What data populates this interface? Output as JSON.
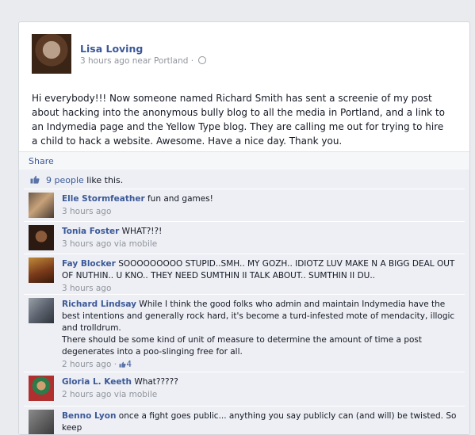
{
  "post": {
    "author": "Lisa Loving",
    "time": "3 hours ago",
    "location": "near Portland",
    "separator": "·",
    "text": "Hi everybody!!! Now someone named Richard Smith has sent a screenie of my post about hacking into the anonymous bully blog to all the media in Portland, and a link to an Indymedia page and the Yellow Type blog. They are calling me out for trying to hire a child to hack a website. Awesome. Have a nice day. Thank you."
  },
  "actions": {
    "share": "Share"
  },
  "likes": {
    "count_text": "9 people",
    "suffix": " like this."
  },
  "comments": [
    {
      "name": "Elle Stormfeather",
      "text": " fun and games!",
      "time": "3 hours ago",
      "via": ""
    },
    {
      "name": "Tonia Foster",
      "text": " WHAT?!?!",
      "time": "3 hours ago",
      "via": " via mobile"
    },
    {
      "name": "Fay Blocker",
      "text": " SOOOOOOOOO STUPID..SMH.. MY GOZH.. IDIOTZ LUV MAKE N A BIGG DEAL OUT OF NUTHIN.. U KNO.. THEY NEED SUMTHIN II TALK ABOUT.. SUMTHIN II DU..",
      "time": "3 hours ago",
      "via": ""
    },
    {
      "name": "Richard Lindsay",
      "text": " While I think the good folks who admin and maintain Indymedia have the best intentions and generally rock hard, it's become a turd-infested mote of mendacity, illogic and trolldrum.",
      "text2": "There should be some kind of unit of measure to determine the amount of time a post degenerates into a poo-slinging free for all.",
      "time": "2 hours ago",
      "separator": " · ",
      "likes": "4"
    },
    {
      "name": "Gloria L. Keeth",
      "text": " What?????",
      "time": "2 hours ago",
      "via": " via mobile"
    },
    {
      "name": "Benno Lyon",
      "text": " once a fight goes public... anything you say publicly can (and will) be twisted. So keep",
      "time": "",
      "via": ""
    }
  ]
}
